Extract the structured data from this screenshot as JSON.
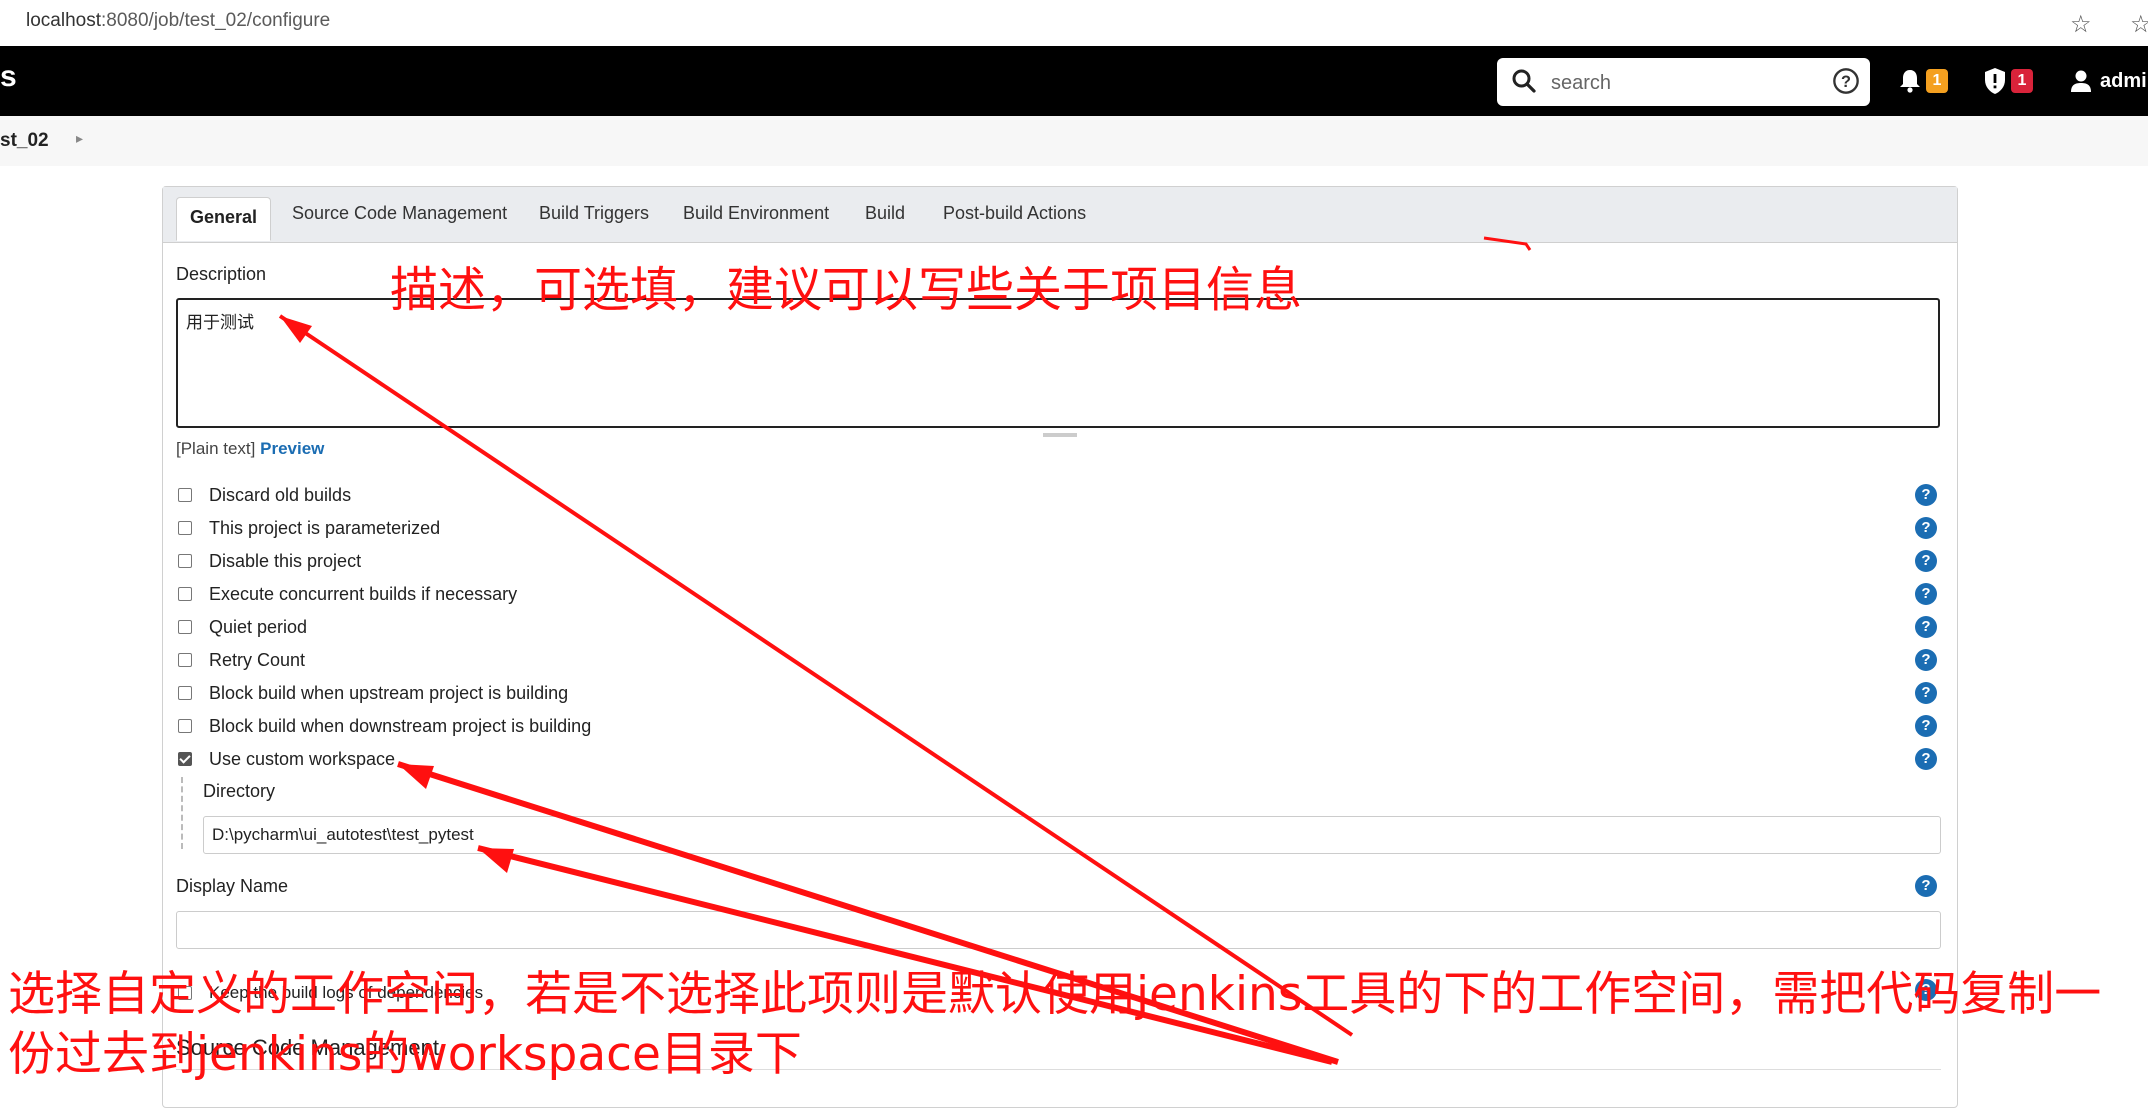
{
  "browser": {
    "url_host": "localhost",
    "url_path": ":8080/job/test_02/configure"
  },
  "header": {
    "logo_fragment": "s",
    "search": {
      "placeholder": "search"
    },
    "notifications": {
      "count": "1"
    },
    "security": {
      "count": "1"
    },
    "user": {
      "name": "admi"
    }
  },
  "breadcrumb": {
    "item": "st_02"
  },
  "tabs": [
    {
      "label": "General"
    },
    {
      "label": "Source Code Management"
    },
    {
      "label": "Build Triggers"
    },
    {
      "label": "Build Environment"
    },
    {
      "label": "Build"
    },
    {
      "label": "Post-build Actions"
    }
  ],
  "general": {
    "description_label": "Description",
    "description_value": "用于测试",
    "markup_prefix": "[Plain text]",
    "preview_link": "Preview",
    "options": [
      {
        "label": "Discard old builds",
        "checked": false
      },
      {
        "label": "This project is parameterized",
        "checked": false
      },
      {
        "label": "Disable this project",
        "checked": false
      },
      {
        "label": "Execute concurrent builds if necessary",
        "checked": false
      },
      {
        "label": "Quiet period",
        "checked": false
      },
      {
        "label": "Retry Count",
        "checked": false
      },
      {
        "label": "Block build when upstream project is building",
        "checked": false
      },
      {
        "label": "Block build when downstream project is building",
        "checked": false
      },
      {
        "label": "Use custom workspace",
        "checked": true
      }
    ],
    "directory_label": "Directory",
    "directory_value": "D:\\pycharm\\ui_autotest\\test_pytest",
    "display_name_label": "Display Name",
    "display_name_value": "",
    "keep_logs_label": "Keep the build logs of dependencies",
    "help_glyph": "?"
  },
  "scm_section": {
    "title": "Source Code Management"
  },
  "annotations": {
    "top": "描述，可选填，建议可以写些关于项目信息",
    "bottom_line1": "选择自定义的工作空间，若是不选择此项则是默认使用jenkins工具的下的工作空间，需把代码复制一",
    "bottom_line2": "份过去到jenkins的workspace目录下",
    "color": "#ff1010"
  }
}
